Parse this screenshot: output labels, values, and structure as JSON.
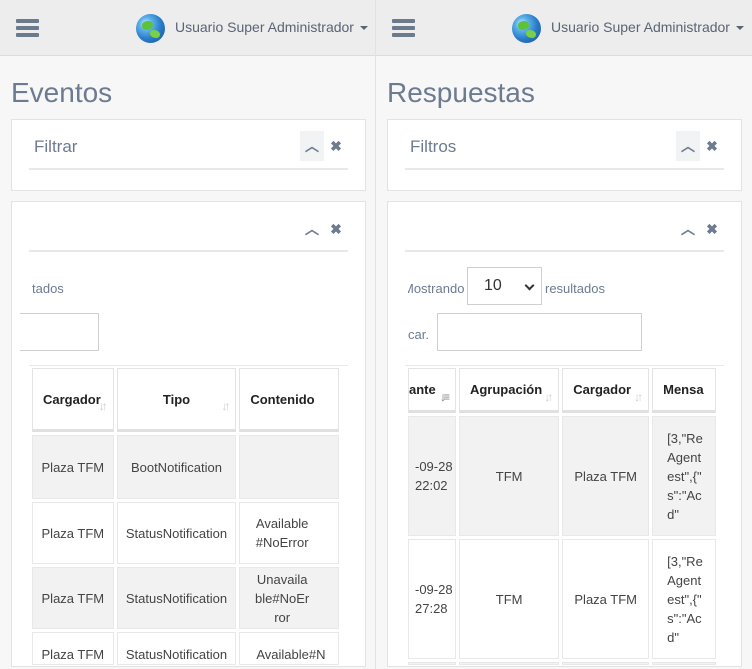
{
  "header": {
    "user_label": "Usuario Super Administrador"
  },
  "left": {
    "title": "Eventos",
    "filter_card": {
      "title": "Filtrar"
    },
    "list_card": {
      "results_fragment": "tados",
      "search_value": ""
    },
    "table": {
      "columns": [
        "Cargador",
        "Tipo",
        "Contenido"
      ],
      "rows": [
        [
          "Plaza TFM",
          "BootNotification",
          ""
        ],
        [
          "Plaza TFM",
          "StatusNotification",
          "Available#NoError"
        ],
        [
          "Plaza TFM",
          "StatusNotification",
          "Unavailable#NoError"
        ],
        [
          "Plaza TFM",
          "StatusNotification",
          "Available#N"
        ]
      ]
    }
  },
  "right": {
    "title": "Respuestas",
    "filter_card": {
      "title": "Filtros"
    },
    "list_card": {
      "show_prefix": "Mostrando",
      "page_size": "10",
      "show_suffix": "resultados",
      "search_label": "car.",
      "search_value": ""
    },
    "table": {
      "columns": [
        "ante",
        "Agrupación",
        "Cargador",
        "Mensa"
      ],
      "rows": [
        [
          "-09-28 22:02",
          "TFM",
          "Plaza TFM",
          "[3,\"Re Agent est\",{\" s\":\"Ac d\""
        ],
        [
          "-09-28 27:28",
          "TFM",
          "Plaza TFM",
          "[3,\"Re Agent est\",{\" s\":\"Ac d\""
        ]
      ]
    }
  },
  "icons": {
    "menu": "hamburger-icon",
    "avatar": "globe-icon",
    "collapse": "chevron-up-icon",
    "close": "close-icon",
    "sort": "sort-icon"
  }
}
